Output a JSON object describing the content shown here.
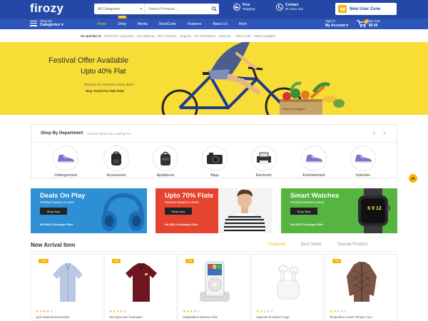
{
  "header": {
    "logo": "firozy",
    "search": {
      "category": "All Categories",
      "placeholder": "Search Products....."
    },
    "shipping": {
      "title": "Free",
      "sub": "Shipping"
    },
    "contact": {
      "title": "Contact",
      "sub": "01 2121 212"
    },
    "new_user_zone": "New User Zone"
  },
  "nav": {
    "shop_by": "Shop By",
    "categories": "Categories",
    "items": [
      "Home",
      "Shop",
      "Media",
      "ShortCode",
      "Features",
      "About Us",
      "More"
    ],
    "hot_badge": "HOT",
    "sign_in": "Sign In",
    "my_account": "My Account",
    "my_cart": "My Cart",
    "cart_total": "$0.00",
    "cart_count": "0"
  },
  "quick_links": {
    "label": "Go quickly to:",
    "links": [
      "Electronic Cigarettes,",
      "Eye Makeup,",
      "Blue Glasses,",
      "Lingerie,",
      "RC Helicopters,",
      "Swimsui...",
      "Tattoo Kits,",
      "Tattoo Supplies"
    ]
  },
  "hero": {
    "title": "Festival Offer Available",
    "subtitle": "Upto 40% Flat",
    "desc": "Discount On Women's Every Items",
    "cta": "Stay Tuned For Sale Date",
    "box_label": "Market Live Veggies"
  },
  "department": {
    "title": "Shop By Department",
    "subtitle": "Choose What You Looking For",
    "items": [
      "Undergarment",
      "Accessories",
      "Appliances",
      "Bags",
      "Electronic",
      "Entertainment",
      "Induction"
    ]
  },
  "banners": [
    {
      "title": "Deals On Play",
      "sub": "Festival Season Is Here",
      "button": "Shop Now",
      "foot": "No EMI | Exchange Offer",
      "bg": "#2f8fd4"
    },
    {
      "title": "Upto 70% Flate",
      "sub": "Festival Season Is Here",
      "button": "Shop Now",
      "foot": "No EMI | Exchange Offer",
      "bg": "#e5452f"
    },
    {
      "title": "Smart Watches",
      "sub": "Festival Season Is Here",
      "button": "Shop Now",
      "foot": "No EMI | Exchange Offer",
      "bg": "#56b540"
    }
  ],
  "watch_face": "6 9 12",
  "new_arrivals": {
    "title": "New Arrival Item",
    "tabs": [
      "Featured",
      "Best Seller",
      "Special Product"
    ],
    "products": [
      {
        "sale": "-10%",
        "name": "Quis Nostrud Exercitation",
        "rating": 4
      },
      {
        "sale": "-5%",
        "name": "Sed Quia Non Numquam",
        "rating": 4
      },
      {
        "sale": "-5%",
        "name": "Voluptatibus Maiores Alias",
        "rating": 4
      },
      {
        "sale": "",
        "name": "Sapiente Et Dictum Fuga",
        "rating": 2
      },
      {
        "sale": "-4%",
        "name": "Temporibus Autem Tempor Cum",
        "rating": 3
      }
    ]
  },
  "colors": {
    "primary": "#2548a6",
    "nav": "#2e55b8",
    "accent": "#f7b500",
    "hero": "#f7dd36"
  }
}
